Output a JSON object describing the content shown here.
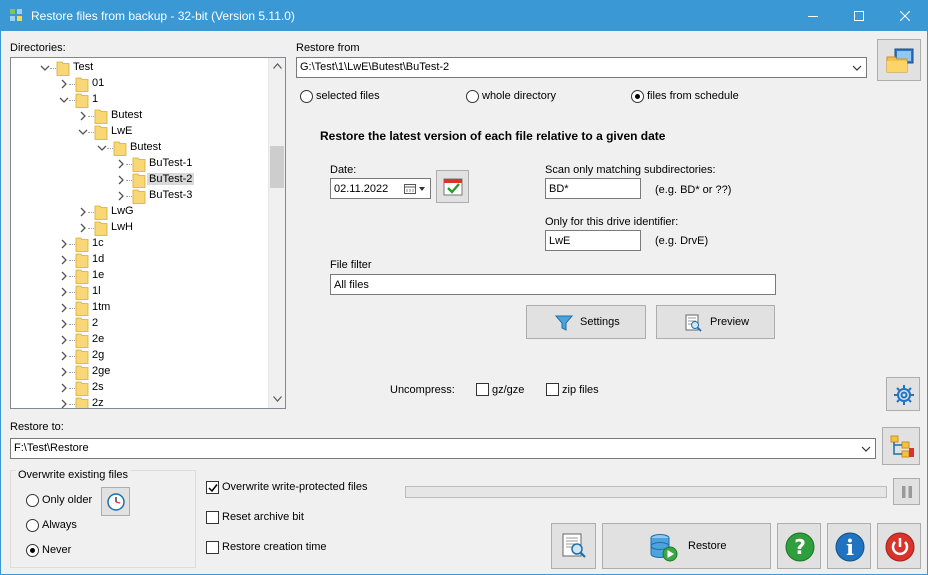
{
  "window": {
    "title": "Restore files from backup - 32-bit (Version 5.11.0)",
    "minimize_glyph": "—",
    "maximize_glyph": "☐",
    "close_glyph": "✕"
  },
  "directories": {
    "label": "Directories:",
    "items": [
      {
        "label": "Test",
        "level": 0,
        "expanded": true
      },
      {
        "label": "01",
        "level": 1
      },
      {
        "label": "1",
        "level": 1,
        "expanded": true
      },
      {
        "label": "Butest",
        "level": 2
      },
      {
        "label": "LwE",
        "level": 2,
        "expanded": true
      },
      {
        "label": "Butest",
        "level": 3,
        "expanded": true
      },
      {
        "label": "BuTest-1",
        "level": 4
      },
      {
        "label": "BuTest-2",
        "level": 4,
        "selected": true
      },
      {
        "label": "BuTest-3",
        "level": 4
      },
      {
        "label": "LwG",
        "level": 2
      },
      {
        "label": "LwH",
        "level": 2
      },
      {
        "label": "1c",
        "level": 1
      },
      {
        "label": "1d",
        "level": 1
      },
      {
        "label": "1e",
        "level": 1
      },
      {
        "label": "1l",
        "level": 1
      },
      {
        "label": "1tm",
        "level": 1
      },
      {
        "label": "2",
        "level": 1
      },
      {
        "label": "2e",
        "level": 1
      },
      {
        "label": "2g",
        "level": 1
      },
      {
        "label": "2ge",
        "level": 1
      },
      {
        "label": "2s",
        "level": 1
      },
      {
        "label": "2z",
        "level": 1
      }
    ]
  },
  "restore_from": {
    "label": "Restore from",
    "value": "G:\\Test\\1\\LwE\\Butest\\BuTest-2",
    "modes": [
      {
        "label": "selected files",
        "selected": false
      },
      {
        "label": "whole directory",
        "selected": false
      },
      {
        "label": "files from schedule",
        "selected": true
      }
    ]
  },
  "schedule": {
    "heading": "Restore the latest version of each file relative to a given date",
    "date_label": "Date:",
    "date_value": "02.11.2022",
    "scan_label": "Scan only matching subdirectories:",
    "scan_value": "BD*",
    "scan_hint": "(e.g. BD* or ??)",
    "drive_label": "Only for this drive identifier:",
    "drive_value": "LwE",
    "drive_hint": "(e.g. DrvE)"
  },
  "file_filter": {
    "label": "File filter",
    "value": "All files"
  },
  "buttons": {
    "settings": "Settings",
    "preview": "Preview",
    "restore": "Restore"
  },
  "uncompress": {
    "label": "Uncompress:",
    "gz_label": "gz/gze",
    "zip_label": "zip files"
  },
  "restore_to": {
    "label": "Restore to:",
    "value": "F:\\Test\\Restore"
  },
  "overwrite": {
    "title": "Overwrite existing files",
    "options": [
      {
        "label": "Only older",
        "selected": false
      },
      {
        "label": "Always",
        "selected": false
      },
      {
        "label": "Never",
        "selected": true
      }
    ]
  },
  "options": {
    "write_protected": {
      "label": "Overwrite write-protected files",
      "checked": true
    },
    "reset_archive": {
      "label": "Reset archive bit",
      "checked": false
    },
    "restore_creation": {
      "label": "Restore creation time",
      "checked": false
    }
  },
  "progress": {
    "value": 0
  }
}
